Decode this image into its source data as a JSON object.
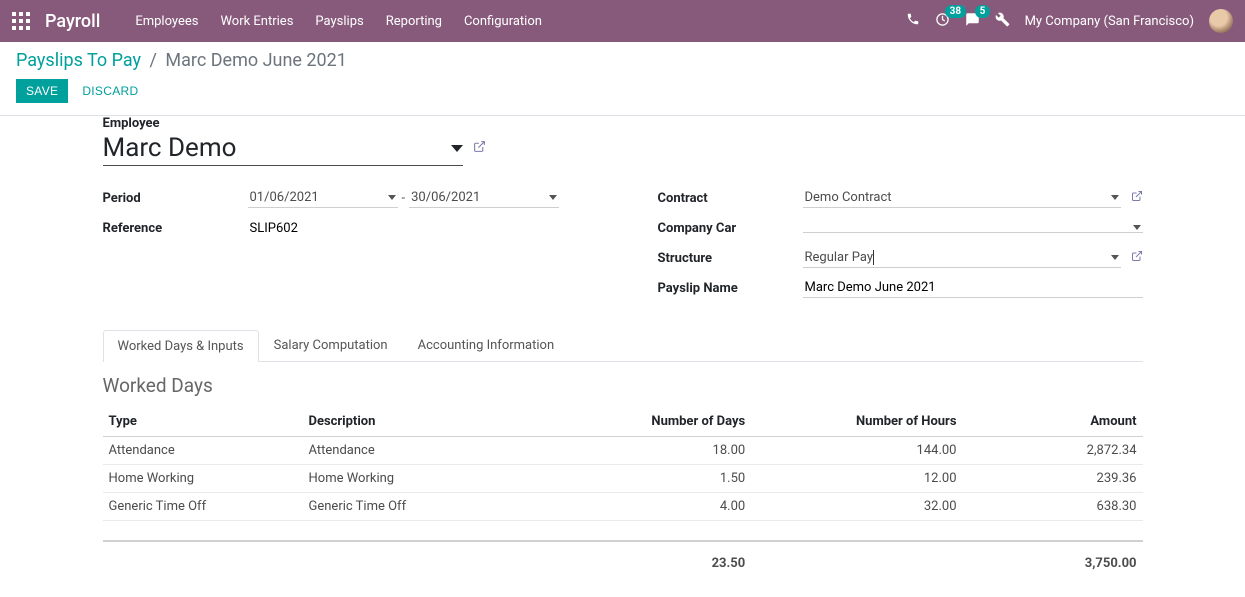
{
  "navbar": {
    "brand": "Payroll",
    "menu": [
      "Employees",
      "Work Entries",
      "Payslips",
      "Reporting",
      "Configuration"
    ],
    "activity_badge": "38",
    "message_badge": "5",
    "company": "My Company (San Francisco)"
  },
  "breadcrumb": {
    "parent": "Payslips To Pay",
    "sep": "/",
    "current": "Marc Demo June 2021"
  },
  "actions": {
    "save": "SAVE",
    "discard": "DISCARD"
  },
  "form": {
    "employee_label": "Employee",
    "employee_value": "Marc Demo",
    "left": {
      "period_label": "Period",
      "period_from": "01/06/2021",
      "period_sep": "-",
      "period_to": "30/06/2021",
      "reference_label": "Reference",
      "reference_value": "SLIP602"
    },
    "right": {
      "contract_label": "Contract",
      "contract_value": "Demo Contract",
      "car_label": "Company Car",
      "car_value": "",
      "structure_label": "Structure",
      "structure_value": "Regular Pay",
      "name_label": "Payslip Name",
      "name_value": "Marc Demo June 2021"
    }
  },
  "tabs": [
    "Worked Days & Inputs",
    "Salary Computation",
    "Accounting Information"
  ],
  "worked_days": {
    "title": "Worked Days",
    "headers": {
      "type": "Type",
      "description": "Description",
      "days": "Number of Days",
      "hours": "Number of Hours",
      "amount": "Amount"
    },
    "rows": [
      {
        "type": "Attendance",
        "description": "Attendance",
        "days": "18.00",
        "hours": "144.00",
        "amount": "2,872.34"
      },
      {
        "type": "Home Working",
        "description": "Home Working",
        "days": "1.50",
        "hours": "12.00",
        "amount": "239.36"
      },
      {
        "type": "Generic Time Off",
        "description": "Generic Time Off",
        "days": "4.00",
        "hours": "32.00",
        "amount": "638.30"
      }
    ],
    "totals": {
      "days": "23.50",
      "amount": "3,750.00"
    }
  }
}
